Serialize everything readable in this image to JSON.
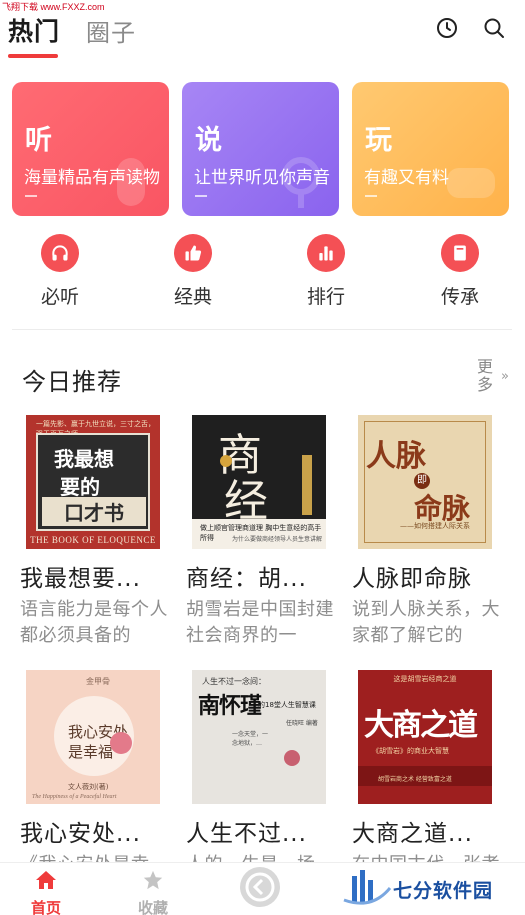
{
  "watermark": {
    "top": "飞翔下载 www.FXXZ.com",
    "brand": "七分软件园"
  },
  "header": {
    "tab_hot": "热门",
    "tab_circle": "圈子"
  },
  "banners": [
    {
      "title": "听",
      "subtitle": "海量精品有声读物",
      "color": "#f95563"
    },
    {
      "title": "说",
      "subtitle": "让世界听见你声音",
      "color": "#8a63ee"
    },
    {
      "title": "玩",
      "subtitle": "有趣又有料",
      "color": "#ffb24a"
    }
  ],
  "categories": [
    {
      "label": "必听",
      "icon": "headphones-icon"
    },
    {
      "label": "经典",
      "icon": "thumbs-up-icon"
    },
    {
      "label": "排行",
      "icon": "bar-chart-icon"
    },
    {
      "label": "传承",
      "icon": "book-icon"
    }
  ],
  "section": {
    "title": "今日推荐",
    "more": "更多",
    "more_arrow": "»"
  },
  "books": [
    {
      "title": "我最想要...",
      "desc": "语言能力是每个人都必须具备的",
      "cover": {
        "top": "一篇先影、赢于九世立说，三寸之舌，强于百万之师",
        "l1": "我最想",
        "l2": "要的",
        "l3": "口才书",
        "eng": "THE BOOK OF ELOQUENCE"
      }
    },
    {
      "title": "商经：胡...",
      "desc": "胡雪岩是中国封建社会商界的一",
      "cover": {
        "c1": "商",
        "c2": "经",
        "bl": "做上顺官管理商道理 胸中生意经的高手所得",
        "bl2": "为什么要做商经领导人员生意讲解"
      }
    },
    {
      "title": "人脉即命脉",
      "desc": "说到人脉关系，大家都了解它的",
      "cover": {
        "t1": "人脉",
        "dot": "即",
        "t2": "命脉",
        "sub": "——如何搭建人际关系"
      }
    },
    {
      "title": "我心安处...",
      "desc": "《我心安处是幸福》",
      "cover": {
        "top": "金甲骨",
        "t": "我心安处\n是幸福",
        "author": "文人薇刘(著)",
        "eng": "The Happiness of a Peaceful Heart"
      }
    },
    {
      "title": "人生不过...",
      "desc": "人的一生是一场",
      "cover": {
        "line1": "人生不过一念间：",
        "name": "南怀瑾",
        "name_s": "的18堂人生智慧课",
        "poem": "一念天堂，一念地狱，…",
        "info": "任晓旺 编著"
      }
    },
    {
      "title": "大商之道...",
      "desc": "在中国古代，张孝",
      "cover": {
        "top": "这是胡雪岩经商之道",
        "t": "大商之道",
        "sub": "《胡雪岩》的商业大智慧",
        "bt": "胡雪岩商之术 经营致富之道"
      }
    }
  ],
  "nav": {
    "home": "首页",
    "favorites": "收藏"
  }
}
